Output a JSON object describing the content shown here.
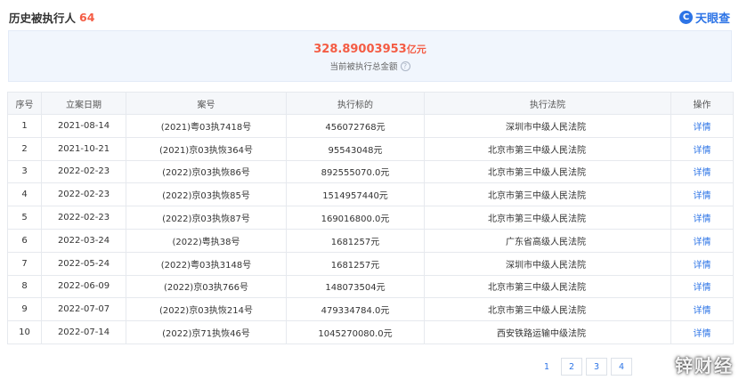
{
  "header": {
    "title": "历史被执行人",
    "count": "64",
    "brand_logo": "C",
    "brand_name": "天眼查"
  },
  "summary": {
    "amount": "328.89003953",
    "unit": "亿元",
    "label": "当前被执行总金额",
    "help_icon": "?"
  },
  "table": {
    "columns": [
      "序号",
      "立案日期",
      "案号",
      "执行标的",
      "执行法院",
      "操作"
    ],
    "rows": [
      {
        "no": "1",
        "date": "2021-08-14",
        "case": "(2021)粤03执7418号",
        "amount": "456072768元",
        "court": "深圳市中级人民法院",
        "action": "详情"
      },
      {
        "no": "2",
        "date": "2021-10-21",
        "case": "(2021)京03执恢364号",
        "amount": "95543048元",
        "court": "北京市第三中级人民法院",
        "action": "详情"
      },
      {
        "no": "3",
        "date": "2022-02-23",
        "case": "(2022)京03执恢86号",
        "amount": "892555070.0元",
        "court": "北京市第三中级人民法院",
        "action": "详情"
      },
      {
        "no": "4",
        "date": "2022-02-23",
        "case": "(2022)京03执恢85号",
        "amount": "1514957440元",
        "court": "北京市第三中级人民法院",
        "action": "详情"
      },
      {
        "no": "5",
        "date": "2022-02-23",
        "case": "(2022)京03执恢87号",
        "amount": "169016800.0元",
        "court": "北京市第三中级人民法院",
        "action": "详情"
      },
      {
        "no": "6",
        "date": "2022-03-24",
        "case": "(2022)粤执38号",
        "amount": "1681257元",
        "court": "广东省高级人民法院",
        "action": "详情"
      },
      {
        "no": "7",
        "date": "2022-05-24",
        "case": "(2022)粤03执3148号",
        "amount": "1681257元",
        "court": "深圳市中级人民法院",
        "action": "详情"
      },
      {
        "no": "8",
        "date": "2022-06-09",
        "case": "(2022)京03执766号",
        "amount": "148073504元",
        "court": "北京市第三中级人民法院",
        "action": "详情"
      },
      {
        "no": "9",
        "date": "2022-07-07",
        "case": "(2022)京03执恢214号",
        "amount": "479334784.0元",
        "court": "北京市第三中级人民法院",
        "action": "详情"
      },
      {
        "no": "10",
        "date": "2022-07-14",
        "case": "(2022)京71执恢46号",
        "amount": "1045270080.0元",
        "court": "西安铁路运输中级法院",
        "action": "详情"
      }
    ]
  },
  "pagination": {
    "pages": [
      "1",
      "2",
      "3",
      "4"
    ],
    "current": "1"
  },
  "watermark": "锌财经",
  "colors": {
    "accent": "#2d74e6",
    "highlight": "#f45c44",
    "summary_bg": "#f1f6fd"
  }
}
